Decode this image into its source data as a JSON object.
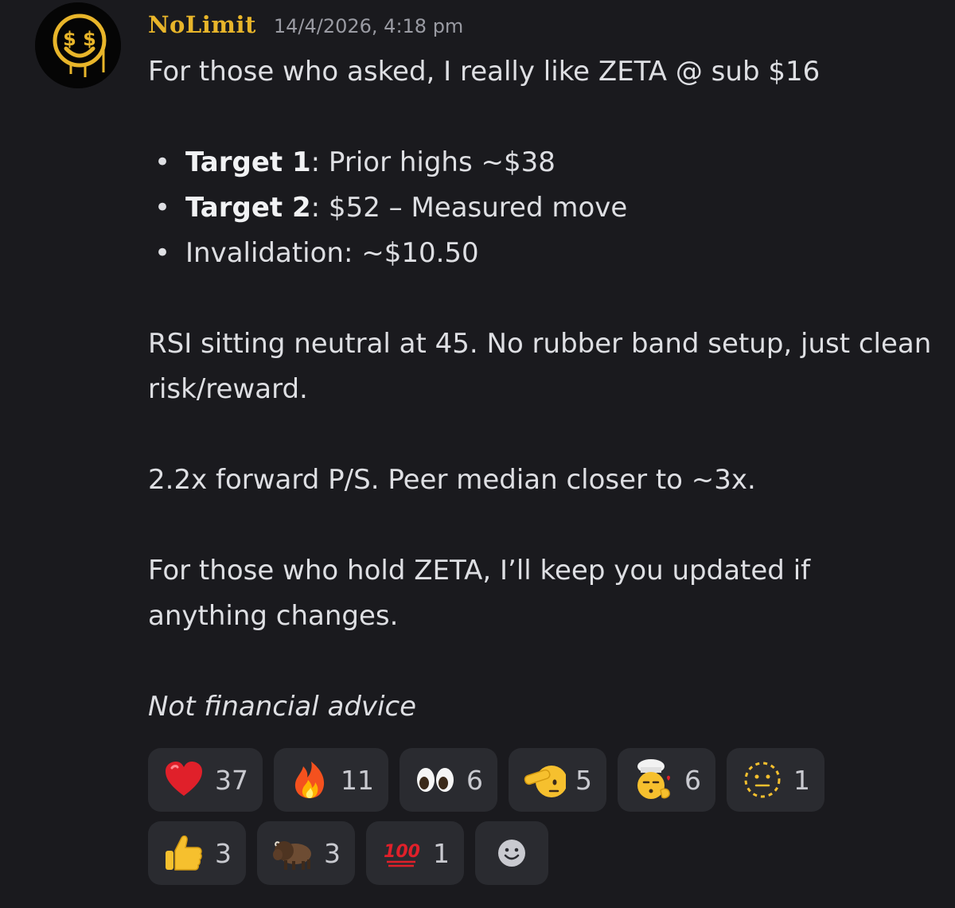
{
  "message": {
    "username": "NoLimit",
    "timestamp": "14/4/2026, 4:18 pm",
    "intro": "For those who asked, I really like ZETA @ sub $16",
    "bullets": [
      {
        "bold": "Target 1",
        "rest": ": Prior highs ~$38"
      },
      {
        "bold": "Target 2",
        "rest": ": $52 – Measured move"
      },
      {
        "bold": "",
        "rest": "Invalidation: ~$10.50"
      }
    ],
    "rsi": "RSI sitting neutral at 45. No rubber band setup, just clean risk/reward.",
    "valuation": "2.2x forward P/S. Peer median closer to ~3x.",
    "update": "For those who hold ZETA, I’ll keep you updated if anything changes.",
    "disclaimer": "Not financial advice"
  },
  "avatar": {
    "icon": "money-smiley-icon",
    "glyph": "$ $"
  },
  "reactions": [
    {
      "icon": "heart-icon",
      "count": "37"
    },
    {
      "icon": "fire-icon",
      "count": "11"
    },
    {
      "icon": "eyes-icon",
      "count": "6"
    },
    {
      "icon": "saluting-face-icon",
      "count": "5"
    },
    {
      "icon": "chef-kiss-icon",
      "count": "6"
    },
    {
      "icon": "dotted-face-icon",
      "count": "1"
    },
    {
      "icon": "thumbs-up-icon",
      "count": "3"
    },
    {
      "icon": "bison-icon",
      "count": "3"
    },
    {
      "icon": "hundred-points-icon",
      "count": "1"
    }
  ],
  "add_reaction": {
    "icon": "add-reaction-smiley-icon"
  },
  "colors": {
    "background": "#1a1a1e",
    "username": "#e8b52a",
    "chip": "#2a2b30",
    "text": "#dedfe3",
    "muted": "#9a9ba3"
  }
}
